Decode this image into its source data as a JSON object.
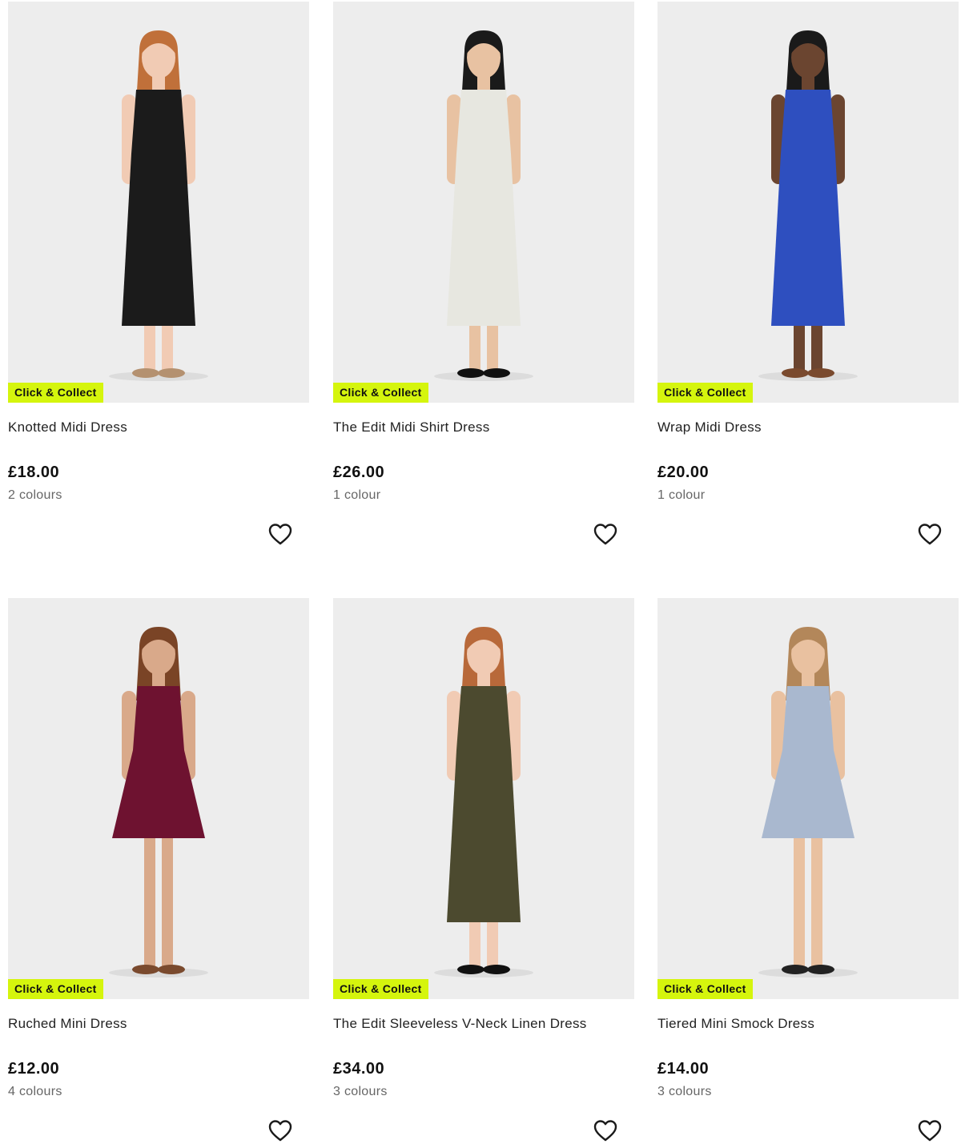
{
  "products": [
    {
      "badge": "Click & Collect",
      "name": "Knotted Midi Dress",
      "price": "£18.00",
      "colours": "2 colours",
      "dress_color": "#1b1b1b",
      "skin": "#f1cbb4",
      "hair": "#c0703a",
      "shoe": "#b49170",
      "style": "midi"
    },
    {
      "badge": "Click & Collect",
      "name": "The Edit Midi Shirt Dress",
      "price": "£26.00",
      "colours": "1 colour",
      "dress_color": "#e7e7e0",
      "skin": "#e8c2a2",
      "hair": "#1a1a1a",
      "shoe": "#111111",
      "style": "midi"
    },
    {
      "badge": "Click & Collect",
      "name": "Wrap Midi Dress",
      "price": "£20.00",
      "colours": "1 colour",
      "dress_color": "#2e4fbf",
      "skin": "#6b4530",
      "hair": "#1a1a1a",
      "shoe": "#7a4a2e",
      "style": "midi"
    },
    {
      "badge": "Click & Collect",
      "name": "Ruched Mini Dress",
      "price": "£12.00",
      "colours": "4 colours",
      "dress_color": "#6e1230",
      "skin": "#d9a98a",
      "hair": "#7a4426",
      "shoe": "#7a4a2e",
      "style": "mini"
    },
    {
      "badge": "Click & Collect",
      "name": "The Edit Sleeveless V-Neck Linen Dress",
      "price": "£34.00",
      "colours": "3 colours",
      "dress_color": "#4c4a2f",
      "skin": "#f1cbb4",
      "hair": "#b8693a",
      "shoe": "#111111",
      "style": "midi"
    },
    {
      "badge": "Click & Collect",
      "name": "Tiered Mini Smock Dress",
      "price": "£14.00",
      "colours": "3 colours",
      "dress_color": "#a9b8cf",
      "skin": "#e9c1a0",
      "hair": "#b3875a",
      "shoe": "#222222",
      "style": "mini"
    }
  ]
}
